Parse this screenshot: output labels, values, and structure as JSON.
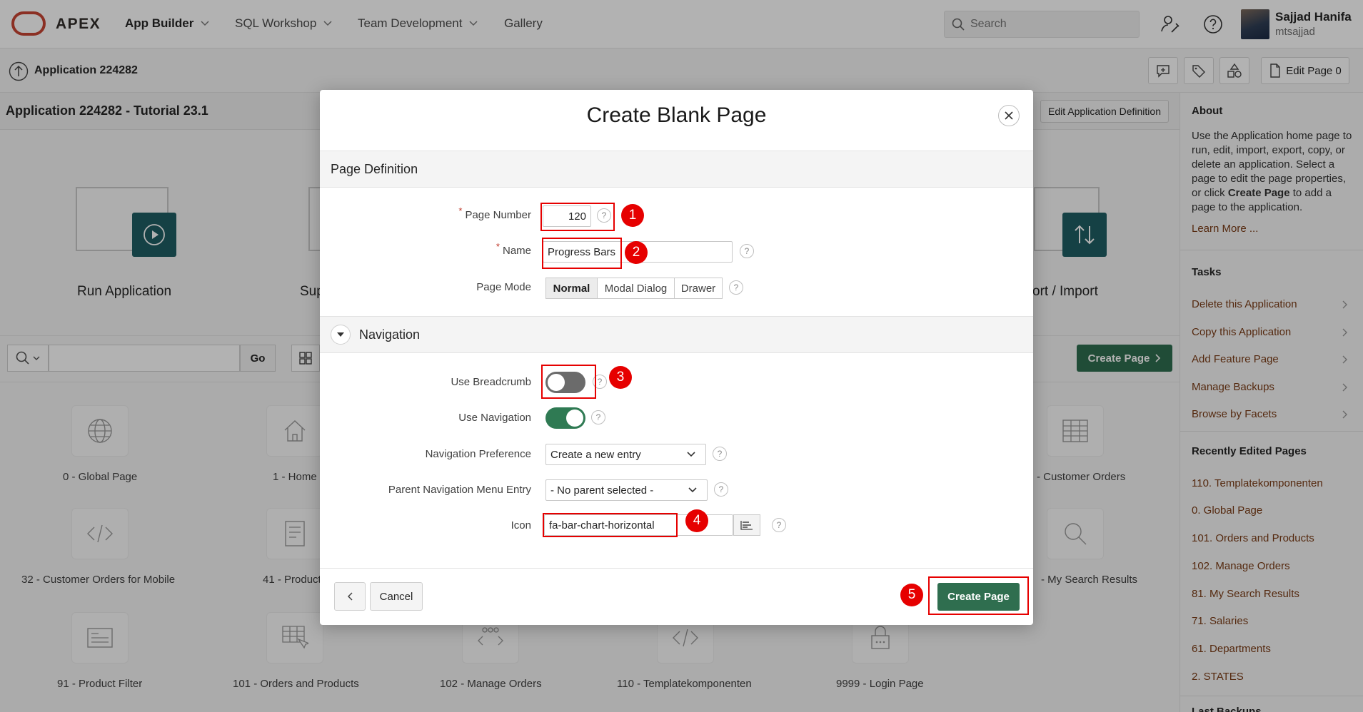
{
  "header": {
    "brand": "APEX",
    "nav": [
      {
        "label": "App Builder"
      },
      {
        "label": "SQL Workshop"
      },
      {
        "label": "Team Development"
      },
      {
        "label": "Gallery"
      }
    ],
    "search_placeholder": "Search",
    "user_name": "Sajjad Hanifa",
    "user_id": "mtsajjad"
  },
  "subheader": {
    "breadcrumb": "Application 224282",
    "edit_page_label": "Edit Page 0"
  },
  "titlebar": {
    "title": "Application 224282 - Tutorial 23.1",
    "edit_def_label": "Edit Application Definition"
  },
  "tiles": [
    {
      "label": "Run Application"
    },
    {
      "label": "Sup"
    },
    {
      "label": "ort / Import"
    }
  ],
  "toolbar": {
    "go_label": "Go",
    "create_page_label": "Create Page"
  },
  "pages": [
    {
      "label": "0 - Global Page"
    },
    {
      "label": "1 - Home"
    },
    {
      "label": "- Customer Orders"
    },
    {
      "label": "32 - Customer Orders for Mobile"
    },
    {
      "label": "41 - Product"
    },
    {
      "label": "- My Search Results"
    },
    {
      "label": "91 - Product Filter"
    },
    {
      "label": "101 - Orders and Products"
    },
    {
      "label": "102 - Manage Orders"
    },
    {
      "label": "110 - Templatekomponenten"
    },
    {
      "label": "9999 - Login Page"
    }
  ],
  "sidebar": {
    "about_title": "About",
    "about_text_1": "Use the Application home page to run, edit, import, export, copy, or delete an application. Select a page to edit the page properties, or click ",
    "about_bold": "Create Page",
    "about_text_2": " to add a page to the application.",
    "learn_more": "Learn More ...",
    "tasks_title": "Tasks",
    "tasks": [
      {
        "label": "Delete this Application"
      },
      {
        "label": "Copy this Application"
      },
      {
        "label": "Add Feature Page"
      },
      {
        "label": "Manage Backups"
      },
      {
        "label": "Browse by Facets"
      }
    ],
    "recent_title": "Recently Edited Pages",
    "recent": [
      {
        "label": "110. Templatekomponenten"
      },
      {
        "label": "0. Global Page"
      },
      {
        "label": "101. Orders and Products"
      },
      {
        "label": "102. Manage Orders"
      },
      {
        "label": "81. My Search Results"
      },
      {
        "label": "71. Salaries"
      },
      {
        "label": "61. Departments"
      },
      {
        "label": "2. STATES"
      }
    ],
    "last_backups_title": "Last Backups"
  },
  "modal": {
    "title": "Create Blank Page",
    "section_page_def": "Page Definition",
    "page_number_label": "Page Number",
    "page_number_value": "120",
    "name_label": "Name",
    "name_value": "Progress Bars",
    "page_mode_label": "Page Mode",
    "page_modes": [
      "Normal",
      "Modal Dialog",
      "Drawer"
    ],
    "page_mode_selected": "Normal",
    "section_navigation": "Navigation",
    "use_breadcrumb_label": "Use Breadcrumb",
    "use_breadcrumb_on": false,
    "use_navigation_label": "Use Navigation",
    "use_navigation_on": true,
    "nav_pref_label": "Navigation Preference",
    "nav_pref_value": "Create a new entry",
    "parent_nav_label": "Parent Navigation Menu Entry",
    "parent_nav_value": "- No parent selected -",
    "icon_label": "Icon",
    "icon_value": "fa-bar-chart-horizontal",
    "help_glyph": "?",
    "cancel_label": "Cancel",
    "create_label": "Create Page"
  },
  "callouts": [
    "1",
    "2",
    "3",
    "4",
    "5"
  ],
  "colors": {
    "accent_green": "#2f6e4f",
    "brand_red": "#c74634",
    "callout_red": "#e60000",
    "link_brown": "#7a3c16"
  }
}
